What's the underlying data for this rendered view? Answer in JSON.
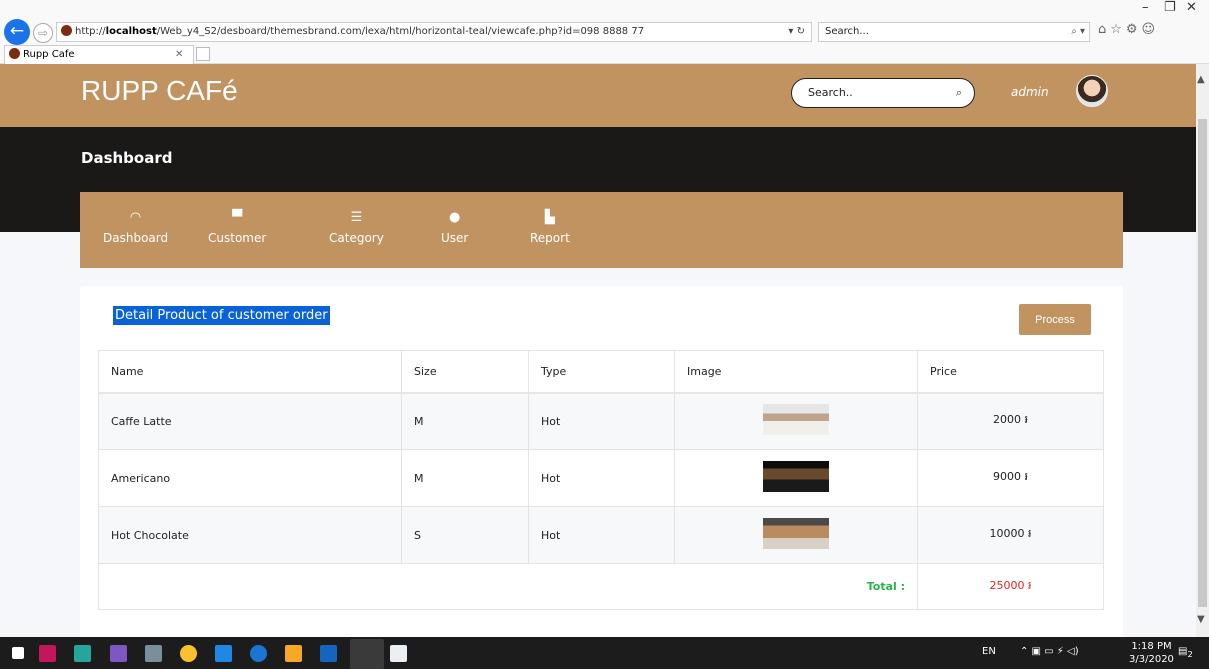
{
  "browser": {
    "url": "http://localhost/Web_y4_S2/desboard/themesbrand.com/lexa/html/horizontal-teal/viewcafe.php?id=098 8888 77",
    "url_prefix": "http://",
    "url_host": "localhost",
    "url_rest": "/Web_y4_S2/desboard/themesbrand.com/lexa/html/horizontal-teal/viewcafe.php?id=098 8888 77",
    "search_placeholder": "Search...",
    "tab_title": "Rupp Cafe"
  },
  "header": {
    "brand": "RUPP CAFé",
    "search_placeholder": "Search..",
    "user": "admin"
  },
  "page_title": "Dashboard",
  "menu": [
    {
      "label": "Dashboard",
      "icon": "dashboard-icon",
      "glyph": "◠"
    },
    {
      "label": "Customer",
      "icon": "customer-icon",
      "glyph": "▀"
    },
    {
      "label": "Category",
      "icon": "category-icon",
      "glyph": "☰"
    },
    {
      "label": "User",
      "icon": "user-icon",
      "glyph": "●"
    },
    {
      "label": "Report",
      "icon": "report-icon",
      "glyph": "▙"
    }
  ],
  "card": {
    "title": "Detail Product of customer order",
    "process_label": "Process",
    "columns": [
      "Name",
      "Size",
      "Type",
      "Image",
      "Price"
    ],
    "rows": [
      {
        "name": "Caffe Latte",
        "size": "M",
        "type": "Hot",
        "price": "2000 ៛"
      },
      {
        "name": "Americano",
        "size": "M",
        "type": "Hot",
        "price": "9000 ៛"
      },
      {
        "name": "Hot Chocolate",
        "size": "S",
        "type": "Hot",
        "price": "10000 ៛"
      }
    ],
    "total_label": "Total :",
    "total_value": "25000 ៛"
  },
  "taskbar": {
    "lang": "EN",
    "time": "1:18 PM",
    "date": "3/3/2020",
    "notif_count": "2"
  },
  "colors": {
    "brand_tan": "#c19361",
    "dark_band": "#1b1918",
    "selection_blue": "#0a63d6",
    "total_green": "#2bb24c",
    "total_red": "#e02424"
  }
}
